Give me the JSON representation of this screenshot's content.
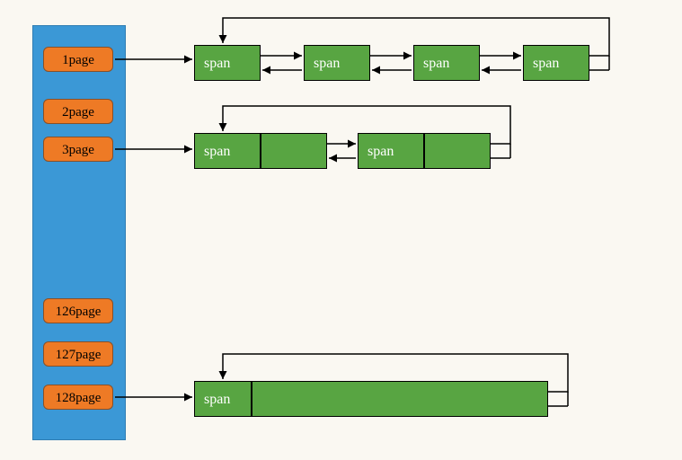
{
  "sidebar": {
    "pages": [
      {
        "label": "1page"
      },
      {
        "label": "2page"
      },
      {
        "label": "3page"
      },
      {
        "label": "126page"
      },
      {
        "label": "127page"
      },
      {
        "label": "128page"
      }
    ]
  },
  "rows": {
    "row1": {
      "spans": [
        "span",
        "span",
        "span",
        "span"
      ]
    },
    "row2": {
      "spans": [
        "span",
        "span"
      ]
    },
    "row3": {
      "spans": [
        "span"
      ]
    }
  }
}
